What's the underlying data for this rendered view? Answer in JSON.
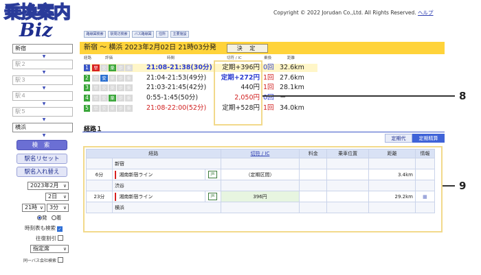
{
  "app": {
    "logo_line1": "乗換案内",
    "logo_line2": "Biz",
    "copyright": "Copyright © 2022 Jorudan Co.,Ltd. All Rights Reserved.",
    "help": "ヘルプ"
  },
  "sidebar": {
    "from": "新宿",
    "via1": "駅２",
    "via2": "駅３",
    "via3": "駅４",
    "via4": "駅５",
    "to": "横浜",
    "search_button": "検 索",
    "reset_button": "駅名リセット",
    "swap_button": "駅名入れ替え",
    "month": "2023年2月",
    "day": "2日",
    "hour": "21時",
    "minute": "3分",
    "departure": "発",
    "arrival": "着",
    "timetable_search": "時刻表も検索",
    "round_trip_discount": "往復割引",
    "seat_type": "指定席",
    "same_bus_company": "同一バス会社検索"
  },
  "top_tabs": [
    "路線図検索",
    "駅周辺検索",
    "バス路線図",
    "住所",
    "主要施設"
  ],
  "route_header": {
    "title": "新宿 ～ 横浜 2023年2月02日 21時03分発",
    "decide_button": "決 定",
    "col_route": "経路",
    "col_eval": "評価",
    "col_time": "時間",
    "col_fare": "切符 / IC",
    "col_transfer": "乗換",
    "col_distance": "距離"
  },
  "routes": [
    {
      "num": "1",
      "badges": [
        "早",
        "安",
        "楽",
        "歩",
        "乗"
      ],
      "time": "21:08-21:38(30分)",
      "fare": "定期+396円",
      "transfers": "0回",
      "distance": "32.6km",
      "highlight": true
    },
    {
      "num": "2",
      "badges": [
        "早",
        "安",
        "楽",
        "歩",
        "乗"
      ],
      "time": "21:04-21:53(49分)",
      "fare": "定期+272円",
      "transfers": "1回",
      "distance": "27.6km",
      "highlight": false
    },
    {
      "num": "3",
      "badges": [
        "早",
        "安",
        "楽",
        "歩",
        "乗"
      ],
      "time": "21:03-21:45(42分)",
      "fare": "440円",
      "transfers": "1回",
      "distance": "28.1km",
      "highlight": false
    },
    {
      "num": "4",
      "badges": [
        "早",
        "安",
        "楽",
        "歩",
        "乗"
      ],
      "time": "0:55-1:45(50分)",
      "fare": "2,050円",
      "transfers": "0回",
      "distance": "－",
      "highlight": false
    },
    {
      "num": "5",
      "badges": [
        "早",
        "安",
        "楽",
        "歩",
        "乗"
      ],
      "time": "21:08-22:00(52分)",
      "fare": "定期+528円",
      "transfers": "1回",
      "distance": "34.0km",
      "highlight": false
    }
  ],
  "route_detail": {
    "title": "経路１",
    "tab_teikidai": "定期代",
    "tab_teikiseisan": "定期精算",
    "headers": {
      "route": "経路",
      "fare": "切符 / IC",
      "charge": "料金",
      "position": "乗車位置",
      "distance": "距離",
      "info": "情報"
    },
    "stations": [
      "新宿",
      "渋谷",
      "横浜"
    ],
    "legs": [
      {
        "duration": "6分",
        "line": "湘南新宿ライン",
        "company": "JR",
        "fare": "（定期区間）",
        "distance": "3.4km"
      },
      {
        "duration": "23分",
        "line": "湘南新宿ライン",
        "company": "JR",
        "fare": "396円",
        "distance": "29.2km"
      }
    ]
  },
  "callouts": [
    "8",
    "9"
  ],
  "colors": {
    "accent": "#3f63d8",
    "header_bar": "#ffd33a",
    "highlight_box": "#f2d98a",
    "route_green": "#3aa63a",
    "route_blue": "#3a56c8"
  }
}
